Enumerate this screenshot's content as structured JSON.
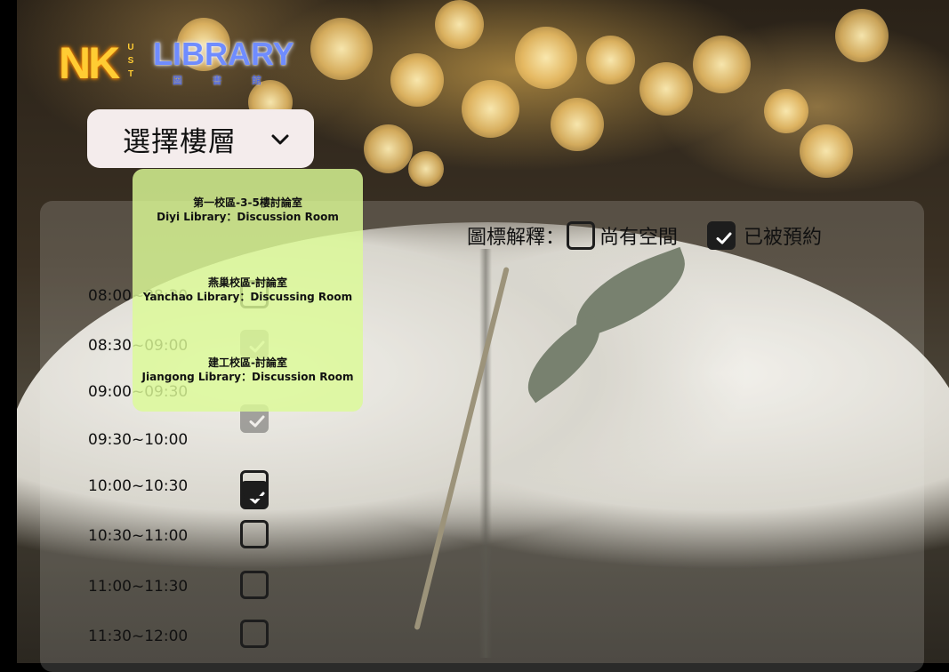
{
  "logo": {
    "nk": "NK",
    "ust": [
      "U",
      "S",
      "T"
    ],
    "library": "LIBRARY",
    "sub": [
      "圖",
      "書",
      "館"
    ]
  },
  "floor_select": {
    "label": "選擇樓層",
    "icon": "chevron-down-icon"
  },
  "legend": {
    "title": "圖標解釋：",
    "available": "尚有空間",
    "booked": "已被預約"
  },
  "dropdown": {
    "options": [
      {
        "zh": "第一校區-3-5樓討論室",
        "en": "Diyi Library：Discussion Room"
      },
      {
        "zh": "燕巢校區-討論室",
        "en": "Yanchao Library：Discussing Room"
      },
      {
        "zh": "建工校區-討論室",
        "en": "Jiangong Library：Discussion Room"
      }
    ]
  },
  "slots": [
    {
      "time": "08:00~08:30",
      "status": "available"
    },
    {
      "time": "08:30~09:00",
      "status": "booked"
    },
    {
      "time": "09:00~09:30",
      "status": "booked"
    },
    {
      "time": "09:30~10:00",
      "status": "booked"
    },
    {
      "time": "10:00~10:30",
      "status": "available"
    },
    {
      "time": "10:30~11:00",
      "status": "available"
    },
    {
      "time": "11:00~11:30",
      "status": "available"
    },
    {
      "time": "11:30~12:00",
      "status": "available"
    }
  ],
  "colors": {
    "dropdown_bg": "#dcfa96",
    "select_bg": "#f4ecec",
    "checkbox": "#1d1d1d",
    "logo_orange": "#ffcc33",
    "logo_blue": "#6f8cff"
  }
}
